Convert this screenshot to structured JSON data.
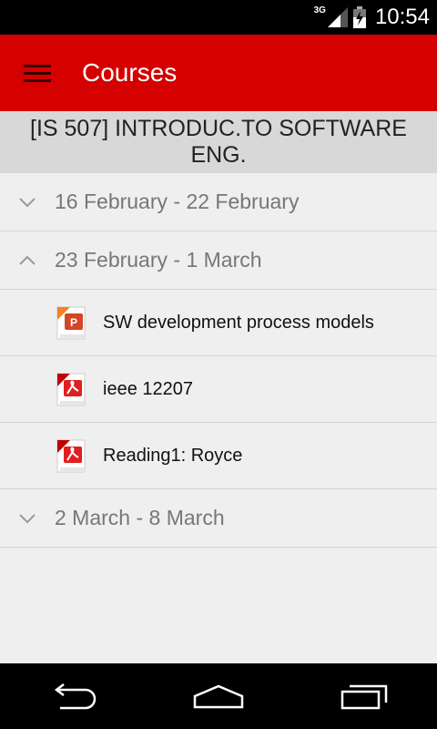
{
  "status_bar": {
    "network": "3G",
    "time": "10:54"
  },
  "app_bar": {
    "title": "Courses"
  },
  "course": {
    "title": "[IS 507] INTRODUC.TO SOFTWARE ENG."
  },
  "weeks": [
    {
      "label": "16 February - 22 February",
      "expanded": false
    },
    {
      "label": "23 February - 1 March",
      "expanded": true,
      "files": [
        {
          "label": "SW development process models",
          "icon": "powerpoint-icon"
        },
        {
          "label": "ieee 12207",
          "icon": "pdf-icon"
        },
        {
          "label": "Reading1: Royce",
          "icon": "pdf-icon"
        }
      ]
    },
    {
      "label": "2 March - 8 March",
      "expanded": false
    }
  ],
  "colors": {
    "accent": "#d50000",
    "background": "#efefef",
    "header": "#d8d8d8"
  }
}
